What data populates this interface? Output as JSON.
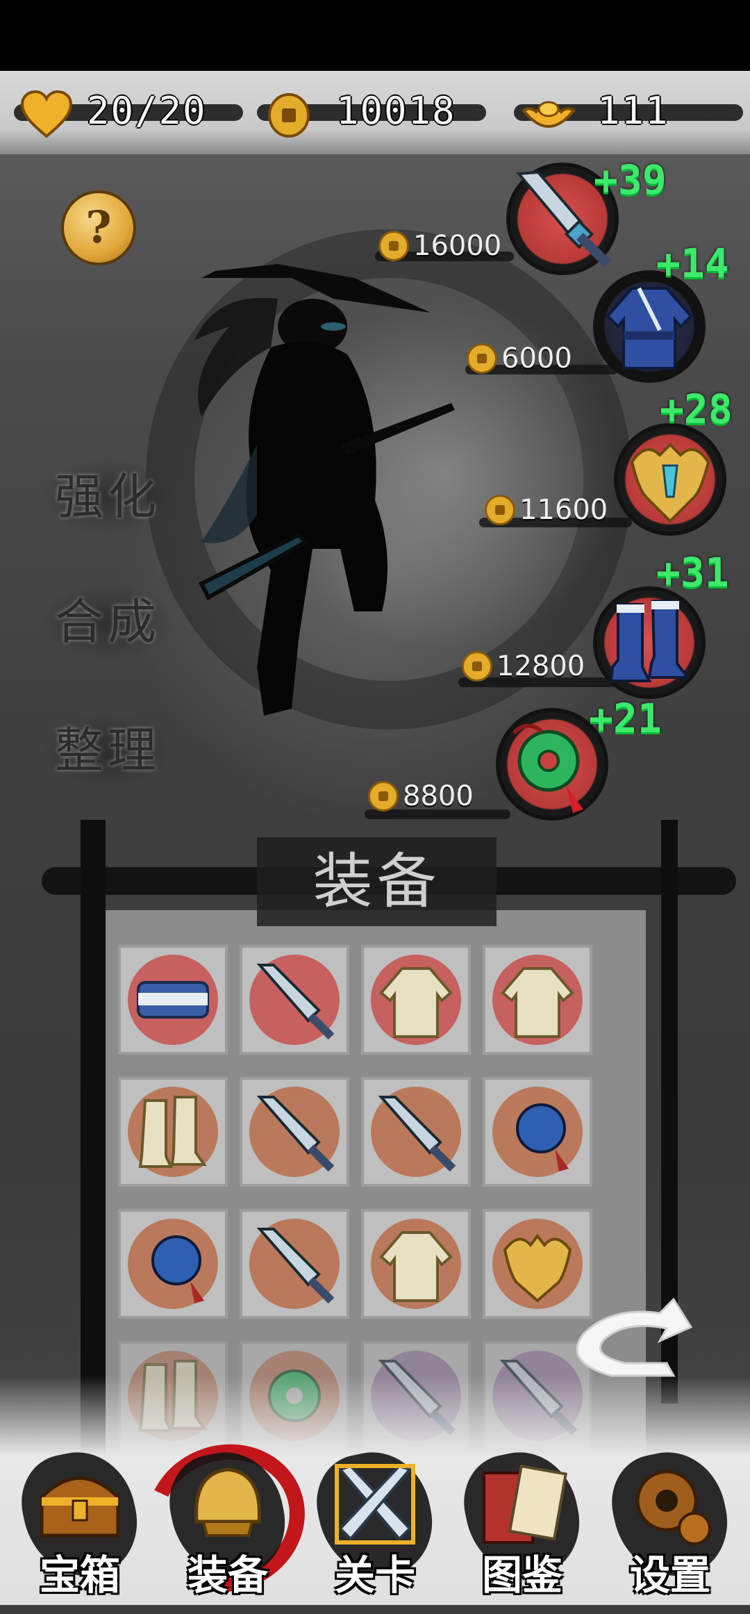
{
  "hud": {
    "hearts": "20/20",
    "coins": "10018",
    "gold_ingots": "111"
  },
  "help": {
    "symbol": "?"
  },
  "side_menu": [
    {
      "label": "强化"
    },
    {
      "label": "合成"
    },
    {
      "label": "整理"
    }
  ],
  "equipment": [
    {
      "slot": "weapon",
      "icon": "sword-icon",
      "bonus": "+39",
      "price": "16000"
    },
    {
      "slot": "armor",
      "icon": "robe-icon",
      "bonus": "+14",
      "price": "6000"
    },
    {
      "slot": "helmet",
      "icon": "helmet-icon",
      "bonus": "+28",
      "price": "11600"
    },
    {
      "slot": "boots",
      "icon": "boots-icon",
      "bonus": "+31",
      "price": "12800"
    },
    {
      "slot": "accessory",
      "icon": "jade-pendant-icon",
      "bonus": "+21",
      "price": "8800"
    }
  ],
  "inventory": {
    "title": "装备",
    "items": [
      [
        "belt-icon",
        "sword-icon",
        "robe-icon",
        "robe-icon"
      ],
      [
        "boots-icon",
        "sword-icon",
        "sword-icon",
        "blue-pendant-icon"
      ],
      [
        "blue-pendant-icon",
        "sword-icon",
        "robe-icon",
        "helmet-icon"
      ],
      [
        "boots-icon",
        "jade-pendant-icon",
        "sword-icon",
        "sword-icon"
      ]
    ]
  },
  "nav": [
    {
      "label": "宝箱",
      "icon": "treasure-chest-icon",
      "active": false
    },
    {
      "label": "装备",
      "icon": "helmet-icon",
      "active": true
    },
    {
      "label": "关卡",
      "icon": "crossed-swords-icon",
      "active": false
    },
    {
      "label": "图鉴",
      "icon": "book-icon",
      "active": false
    },
    {
      "label": "设置",
      "icon": "gear-icon",
      "active": false
    }
  ],
  "colors": {
    "bonus_green": "#3ee86a",
    "coin_gold": "#e3ad2b",
    "slot_red": "#c8413f",
    "active_ring": "#c3161b"
  }
}
